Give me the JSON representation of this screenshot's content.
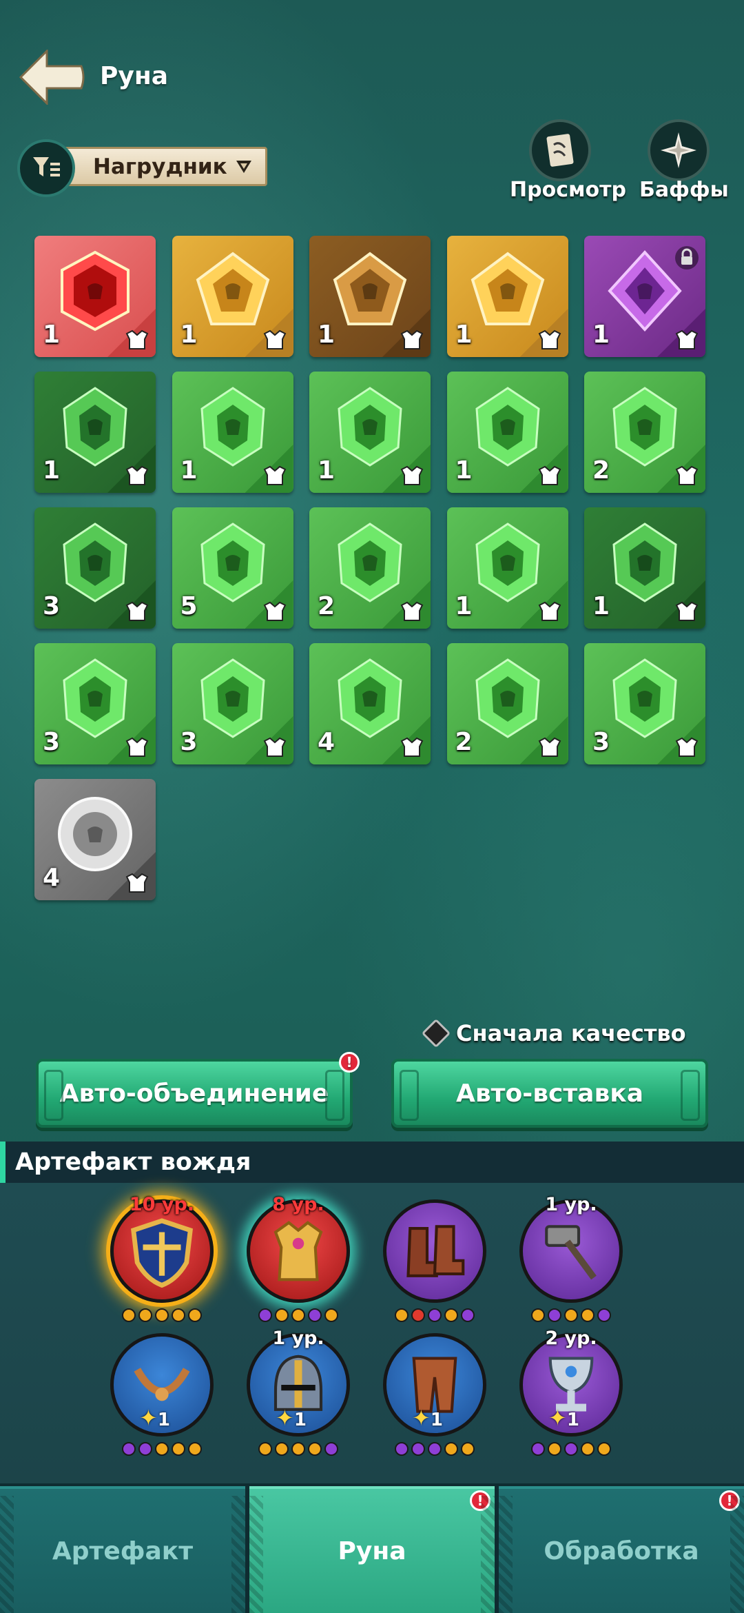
{
  "header": {
    "title": "Руна",
    "back_icon": "back-arrow-icon"
  },
  "filter": {
    "selected": "Нагрудник",
    "icon": "filter-icon"
  },
  "actions": {
    "view_label": "Просмотр",
    "buffs_label": "Баффы"
  },
  "runes": [
    {
      "quality": "red",
      "gem": "hexagon",
      "count": "1"
    },
    {
      "quality": "gold",
      "gem": "pentagon",
      "count": "1"
    },
    {
      "quality": "gold-dark",
      "gem": "pentagon",
      "count": "1"
    },
    {
      "quality": "gold",
      "gem": "pentagon",
      "count": "1"
    },
    {
      "quality": "purple",
      "gem": "diamond",
      "count": "1",
      "locked": true
    },
    {
      "quality": "green-dark",
      "gem": "crystal",
      "count": "1"
    },
    {
      "quality": "green",
      "gem": "crystal",
      "count": "1"
    },
    {
      "quality": "green",
      "gem": "crystal",
      "count": "1"
    },
    {
      "quality": "green",
      "gem": "crystal",
      "count": "1"
    },
    {
      "quality": "green",
      "gem": "crystal",
      "count": "2"
    },
    {
      "quality": "green-dark",
      "gem": "crystal",
      "count": "3"
    },
    {
      "quality": "green",
      "gem": "crystal",
      "count": "5"
    },
    {
      "quality": "green",
      "gem": "crystal",
      "count": "2"
    },
    {
      "quality": "green",
      "gem": "crystal",
      "count": "1"
    },
    {
      "quality": "green-dark",
      "gem": "crystal",
      "count": "1"
    },
    {
      "quality": "green",
      "gem": "crystal",
      "count": "3"
    },
    {
      "quality": "green",
      "gem": "crystal",
      "count": "3"
    },
    {
      "quality": "green",
      "gem": "crystal",
      "count": "4"
    },
    {
      "quality": "green",
      "gem": "crystal",
      "count": "2"
    },
    {
      "quality": "green",
      "gem": "crystal",
      "count": "3"
    },
    {
      "quality": "gray",
      "gem": "round",
      "count": "4"
    }
  ],
  "quality_toggle": {
    "label": "Сначала качество",
    "checked": false
  },
  "buttons": {
    "auto_merge": "Авто-объединение",
    "auto_insert": "Авто-вставка",
    "auto_merge_badge": "!"
  },
  "artifacts": {
    "title": "Артефакт вождя",
    "items": [
      {
        "name": "shield-artifact",
        "color": "red",
        "level": "10 ур.",
        "level_red": true,
        "dots": [
          "#f0a81c",
          "#f0a81c",
          "#f0a81c",
          "#f0a81c",
          "#f0a81c"
        ],
        "glow": "gold"
      },
      {
        "name": "armor-artifact",
        "color": "red",
        "level": "8 ур.",
        "level_red": true,
        "dots": [
          "#8e3fd6",
          "#f0a81c",
          "#f0a81c",
          "#8e3fd6",
          "#f0a81c"
        ],
        "glow": "teal"
      },
      {
        "name": "boots-artifact",
        "color": "purple",
        "level": "",
        "dots": [
          "#f0a81c",
          "#e03a2e",
          "#8e3fd6",
          "#f0a81c",
          "#8e3fd6"
        ]
      },
      {
        "name": "hammer-artifact",
        "color": "purple",
        "level": "1 ур.",
        "dots": [
          "#f0a81c",
          "#8e3fd6",
          "#f0a81c",
          "#f0a81c",
          "#8e3fd6"
        ]
      },
      {
        "name": "necklace-artifact",
        "color": "blue",
        "level": "",
        "star": "1",
        "dots": [
          "#8e3fd6",
          "#8e3fd6",
          "#f0a81c",
          "#f0a81c",
          "#f0a81c"
        ]
      },
      {
        "name": "helmet-artifact",
        "color": "blue",
        "level": "1 ур.",
        "star": "1",
        "dots": [
          "#f0a81c",
          "#f0a81c",
          "#f0a81c",
          "#f0a81c",
          "#8e3fd6"
        ]
      },
      {
        "name": "pants-artifact",
        "color": "blue",
        "level": "",
        "star": "1",
        "dots": [
          "#8e3fd6",
          "#8e3fd6",
          "#8e3fd6",
          "#f0a81c",
          "#f0a81c"
        ]
      },
      {
        "name": "chalice-artifact",
        "color": "purple",
        "level": "2 ур.",
        "star": "1",
        "dots": [
          "#8e3fd6",
          "#f0a81c",
          "#8e3fd6",
          "#f0a81c",
          "#f0a81c"
        ]
      }
    ]
  },
  "tabs": [
    {
      "label": "Артефакт",
      "active": false,
      "badge": false
    },
    {
      "label": "Руна",
      "active": true,
      "badge": true
    },
    {
      "label": "Обработка",
      "active": false,
      "badge": true
    }
  ],
  "colors": {
    "accent": "#2fd6a2",
    "badge": "#e2283a"
  }
}
